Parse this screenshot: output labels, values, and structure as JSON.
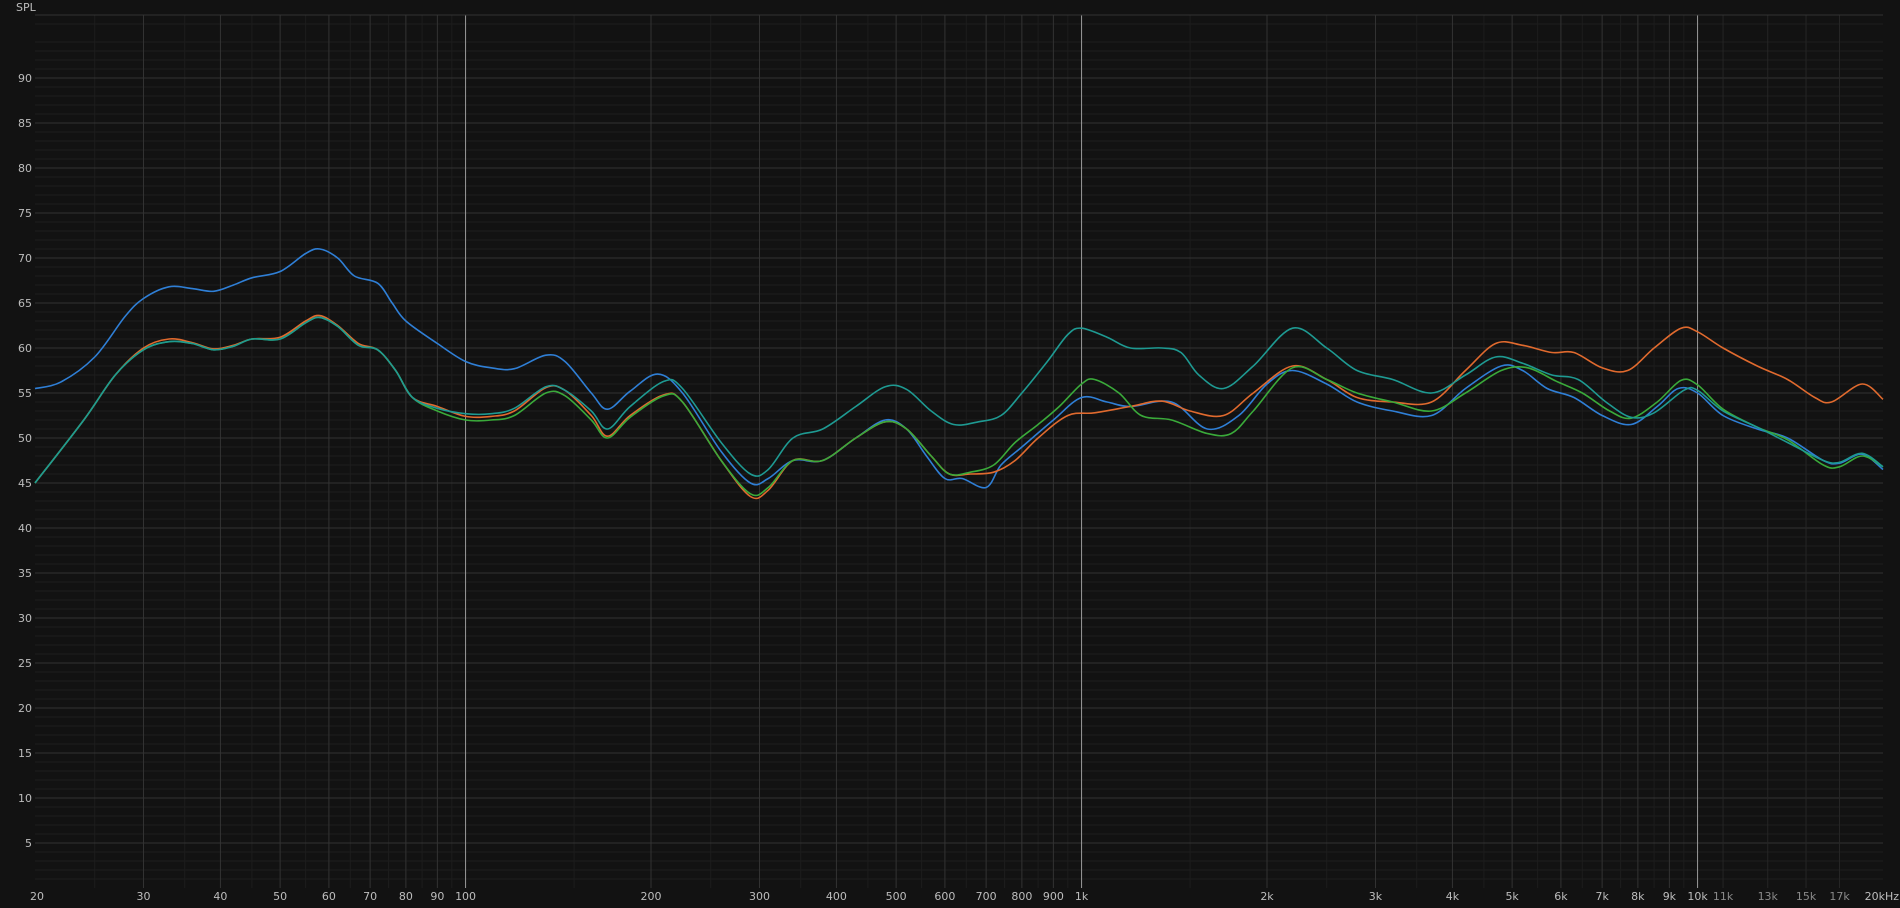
{
  "chart_data": {
    "type": "line",
    "ylabel": "SPL",
    "xscale": "log",
    "xlim": [
      20,
      20000
    ],
    "ylim": [
      0,
      97
    ],
    "grid": true,
    "y_ticks": [
      5,
      10,
      15,
      20,
      25,
      30,
      35,
      40,
      45,
      50,
      55,
      60,
      65,
      70,
      75,
      80,
      85,
      90
    ],
    "x_ticks": [
      {
        "value": 20,
        "label": "20"
      },
      {
        "value": 30,
        "label": "30"
      },
      {
        "value": 40,
        "label": "40"
      },
      {
        "value": 50,
        "label": "50"
      },
      {
        "value": 60,
        "label": "60"
      },
      {
        "value": 70,
        "label": "70"
      },
      {
        "value": 80,
        "label": "80"
      },
      {
        "value": 90,
        "label": "90"
      },
      {
        "value": 100,
        "label": "100"
      },
      {
        "value": 200,
        "label": "200"
      },
      {
        "value": 300,
        "label": "300"
      },
      {
        "value": 400,
        "label": "400"
      },
      {
        "value": 500,
        "label": "500"
      },
      {
        "value": 600,
        "label": "600"
      },
      {
        "value": 700,
        "label": "700"
      },
      {
        "value": 800,
        "label": "800"
      },
      {
        "value": 900,
        "label": "900"
      },
      {
        "value": 1000,
        "label": "1k"
      },
      {
        "value": 2000,
        "label": "2k"
      },
      {
        "value": 3000,
        "label": "3k"
      },
      {
        "value": 4000,
        "label": "4k"
      },
      {
        "value": 5000,
        "label": "5k"
      },
      {
        "value": 6000,
        "label": "6k"
      },
      {
        "value": 7000,
        "label": "7k"
      },
      {
        "value": 8000,
        "label": "8k"
      },
      {
        "value": 9000,
        "label": "9k"
      },
      {
        "value": 10000,
        "label": "10k"
      },
      {
        "value": 11000,
        "label": "11k",
        "minor": true
      },
      {
        "value": 13000,
        "label": "13k",
        "minor": true
      },
      {
        "value": 15000,
        "label": "15k",
        "minor": true
      },
      {
        "value": 17000,
        "label": "17k",
        "minor": true
      },
      {
        "value": 20000,
        "label": "20kHz"
      }
    ],
    "series": [
      {
        "color": "#2f7fd6",
        "points": [
          [
            20,
            55.5
          ],
          [
            22,
            56.2
          ],
          [
            25,
            59
          ],
          [
            28,
            63.5
          ],
          [
            30,
            65.5
          ],
          [
            33,
            66.8
          ],
          [
            36,
            66.6
          ],
          [
            39,
            66.3
          ],
          [
            42,
            67
          ],
          [
            45,
            67.8
          ],
          [
            50,
            68.5
          ],
          [
            55,
            70.5
          ],
          [
            58,
            71
          ],
          [
            62,
            70
          ],
          [
            66,
            68
          ],
          [
            72,
            67.2
          ],
          [
            76,
            65
          ],
          [
            80,
            63
          ],
          [
            90,
            60.5
          ],
          [
            100,
            58.5
          ],
          [
            110,
            57.8
          ],
          [
            120,
            57.7
          ],
          [
            135,
            59.2
          ],
          [
            145,
            58.5
          ],
          [
            160,
            55
          ],
          [
            170,
            53.2
          ],
          [
            185,
            55.2
          ],
          [
            205,
            57.1
          ],
          [
            225,
            55
          ],
          [
            260,
            48.5
          ],
          [
            290,
            45
          ],
          [
            310,
            45.5
          ],
          [
            340,
            47.5
          ],
          [
            380,
            47.5
          ],
          [
            430,
            50
          ],
          [
            480,
            52
          ],
          [
            520,
            51
          ],
          [
            560,
            48
          ],
          [
            600,
            45.5
          ],
          [
            640,
            45.5
          ],
          [
            700,
            44.5
          ],
          [
            740,
            47
          ],
          [
            800,
            49
          ],
          [
            900,
            52
          ],
          [
            1000,
            54.5
          ],
          [
            1100,
            54
          ],
          [
            1200,
            53.5
          ],
          [
            1400,
            54
          ],
          [
            1600,
            51
          ],
          [
            1800,
            52.5
          ],
          [
            2000,
            56
          ],
          [
            2200,
            57.5
          ],
          [
            2500,
            56
          ],
          [
            2800,
            54
          ],
          [
            3200,
            53
          ],
          [
            3700,
            52.5
          ],
          [
            4200,
            55.5
          ],
          [
            4800,
            58
          ],
          [
            5200,
            57.5
          ],
          [
            5700,
            55.5
          ],
          [
            6300,
            54.5
          ],
          [
            7000,
            52.5
          ],
          [
            7800,
            51.5
          ],
          [
            8600,
            53.5
          ],
          [
            9300,
            55.5
          ],
          [
            10000,
            55
          ],
          [
            11000,
            52.5
          ],
          [
            12500,
            51
          ],
          [
            14000,
            50
          ],
          [
            16000,
            47.5
          ],
          [
            17000,
            47.2
          ],
          [
            18500,
            48.2
          ],
          [
            20000,
            46.5
          ]
        ]
      },
      {
        "color": "#e06a2e",
        "points": [
          [
            20,
            45
          ],
          [
            24,
            52
          ],
          [
            27,
            57
          ],
          [
            30,
            60
          ],
          [
            33,
            61
          ],
          [
            36,
            60.6
          ],
          [
            39,
            59.9
          ],
          [
            42,
            60.3
          ],
          [
            45,
            61
          ],
          [
            50,
            61.2
          ],
          [
            55,
            63
          ],
          [
            58,
            63.6
          ],
          [
            62,
            62.5
          ],
          [
            67,
            60.5
          ],
          [
            72,
            59.8
          ],
          [
            77,
            57.5
          ],
          [
            82,
            54.5
          ],
          [
            90,
            53.5
          ],
          [
            100,
            52.4
          ],
          [
            110,
            52.4
          ],
          [
            120,
            53
          ],
          [
            135,
            55.6
          ],
          [
            145,
            55.3
          ],
          [
            160,
            52.5
          ],
          [
            170,
            50.2
          ],
          [
            185,
            52.5
          ],
          [
            210,
            54.8
          ],
          [
            225,
            54
          ],
          [
            260,
            47.5
          ],
          [
            290,
            43.5
          ],
          [
            310,
            44.2
          ],
          [
            340,
            47.5
          ],
          [
            380,
            47.5
          ],
          [
            430,
            50
          ],
          [
            480,
            51.8
          ],
          [
            520,
            51
          ],
          [
            570,
            48
          ],
          [
            610,
            46
          ],
          [
            660,
            46
          ],
          [
            720,
            46.2
          ],
          [
            780,
            47.5
          ],
          [
            850,
            50
          ],
          [
            950,
            52.5
          ],
          [
            1050,
            52.8
          ],
          [
            1200,
            53.5
          ],
          [
            1350,
            54.1
          ],
          [
            1500,
            53
          ],
          [
            1700,
            52.5
          ],
          [
            1900,
            55
          ],
          [
            2200,
            58
          ],
          [
            2500,
            56.5
          ],
          [
            2800,
            54.5
          ],
          [
            3200,
            54
          ],
          [
            3700,
            54
          ],
          [
            4200,
            57.5
          ],
          [
            4700,
            60.5
          ],
          [
            5200,
            60.3
          ],
          [
            5800,
            59.5
          ],
          [
            6300,
            59.5
          ],
          [
            7000,
            57.8
          ],
          [
            7700,
            57.5
          ],
          [
            8500,
            60
          ],
          [
            9400,
            62.2
          ],
          [
            10000,
            61.8
          ],
          [
            11000,
            60
          ],
          [
            12500,
            58
          ],
          [
            14000,
            56.5
          ],
          [
            15500,
            54.5
          ],
          [
            16500,
            54
          ],
          [
            18500,
            56
          ],
          [
            20000,
            54.3
          ]
        ]
      },
      {
        "color": "#3aaa3a",
        "points": [
          [
            20,
            45
          ],
          [
            24,
            52
          ],
          [
            27,
            57
          ],
          [
            30,
            59.8
          ],
          [
            33,
            60.7
          ],
          [
            36,
            60.5
          ],
          [
            39,
            59.8
          ],
          [
            42,
            60.2
          ],
          [
            45,
            61
          ],
          [
            50,
            61
          ],
          [
            55,
            62.8
          ],
          [
            58,
            63.4
          ],
          [
            62,
            62.4
          ],
          [
            67,
            60.3
          ],
          [
            72,
            59.8
          ],
          [
            77,
            57.5
          ],
          [
            82,
            54.5
          ],
          [
            90,
            53
          ],
          [
            100,
            52
          ],
          [
            110,
            52
          ],
          [
            120,
            52.5
          ],
          [
            135,
            55
          ],
          [
            145,
            54.7
          ],
          [
            160,
            52
          ],
          [
            170,
            50
          ],
          [
            185,
            52.3
          ],
          [
            210,
            54.7
          ],
          [
            225,
            54
          ],
          [
            260,
            47.5
          ],
          [
            290,
            43.8
          ],
          [
            310,
            44.5
          ],
          [
            340,
            47.5
          ],
          [
            380,
            47.5
          ],
          [
            430,
            50
          ],
          [
            480,
            51.8
          ],
          [
            520,
            51
          ],
          [
            570,
            48
          ],
          [
            610,
            46
          ],
          [
            660,
            46.2
          ],
          [
            720,
            47
          ],
          [
            780,
            49.5
          ],
          [
            850,
            51.5
          ],
          [
            920,
            53.5
          ],
          [
            1000,
            56
          ],
          [
            1050,
            56.5
          ],
          [
            1150,
            55
          ],
          [
            1250,
            52.5
          ],
          [
            1400,
            52
          ],
          [
            1600,
            50.5
          ],
          [
            1750,
            50.5
          ],
          [
            1900,
            53
          ],
          [
            2200,
            57.8
          ],
          [
            2500,
            56.5
          ],
          [
            2800,
            55
          ],
          [
            3200,
            54
          ],
          [
            3700,
            53
          ],
          [
            4200,
            55
          ],
          [
            4800,
            57.5
          ],
          [
            5300,
            57.8
          ],
          [
            5900,
            56.3
          ],
          [
            6500,
            55
          ],
          [
            7200,
            53
          ],
          [
            7800,
            52.2
          ],
          [
            8600,
            54
          ],
          [
            9400,
            56.4
          ],
          [
            10000,
            55.9
          ],
          [
            11000,
            53.2
          ],
          [
            12500,
            51.2
          ],
          [
            14000,
            49.8
          ],
          [
            16000,
            47
          ],
          [
            17000,
            46.8
          ],
          [
            18500,
            48
          ],
          [
            20000,
            46.8
          ]
        ]
      },
      {
        "color": "#1e9a92",
        "points": [
          [
            20,
            45
          ],
          [
            24,
            52
          ],
          [
            27,
            57
          ],
          [
            30,
            59.8
          ],
          [
            33,
            60.7
          ],
          [
            36,
            60.5
          ],
          [
            39,
            59.8
          ],
          [
            42,
            60.2
          ],
          [
            45,
            61
          ],
          [
            50,
            61
          ],
          [
            55,
            62.8
          ],
          [
            58,
            63.4
          ],
          [
            62,
            62.4
          ],
          [
            67,
            60.3
          ],
          [
            72,
            59.8
          ],
          [
            77,
            57.5
          ],
          [
            82,
            54.5
          ],
          [
            90,
            53.3
          ],
          [
            100,
            52.7
          ],
          [
            110,
            52.7
          ],
          [
            120,
            53.3
          ],
          [
            135,
            55.7
          ],
          [
            145,
            55.3
          ],
          [
            160,
            53
          ],
          [
            170,
            51
          ],
          [
            185,
            53.5
          ],
          [
            210,
            56.3
          ],
          [
            225,
            55.5
          ],
          [
            260,
            49.5
          ],
          [
            290,
            46
          ],
          [
            310,
            46.5
          ],
          [
            340,
            50
          ],
          [
            380,
            51
          ],
          [
            430,
            53.5
          ],
          [
            480,
            55.7
          ],
          [
            520,
            55.4
          ],
          [
            570,
            53
          ],
          [
            620,
            51.5
          ],
          [
            680,
            51.8
          ],
          [
            740,
            52.5
          ],
          [
            800,
            55
          ],
          [
            880,
            58.5
          ],
          [
            950,
            61.5
          ],
          [
            1000,
            62.2
          ],
          [
            1100,
            61.2
          ],
          [
            1200,
            60
          ],
          [
            1350,
            60
          ],
          [
            1450,
            59.5
          ],
          [
            1550,
            57
          ],
          [
            1700,
            55.5
          ],
          [
            1900,
            58
          ],
          [
            2200,
            62.2
          ],
          [
            2500,
            60
          ],
          [
            2800,
            57.5
          ],
          [
            3200,
            56.5
          ],
          [
            3700,
            55
          ],
          [
            4200,
            57
          ],
          [
            4700,
            59
          ],
          [
            5200,
            58.3
          ],
          [
            5800,
            57
          ],
          [
            6400,
            56.5
          ],
          [
            7100,
            54
          ],
          [
            7800,
            52.3
          ],
          [
            8500,
            52.8
          ],
          [
            9500,
            55.3
          ],
          [
            10000,
            55.3
          ],
          [
            11000,
            53
          ],
          [
            12500,
            51.2
          ],
          [
            14000,
            49.5
          ],
          [
            16000,
            47.5
          ],
          [
            17000,
            47.3
          ],
          [
            18500,
            48.3
          ],
          [
            20000,
            46.8
          ]
        ]
      }
    ]
  }
}
